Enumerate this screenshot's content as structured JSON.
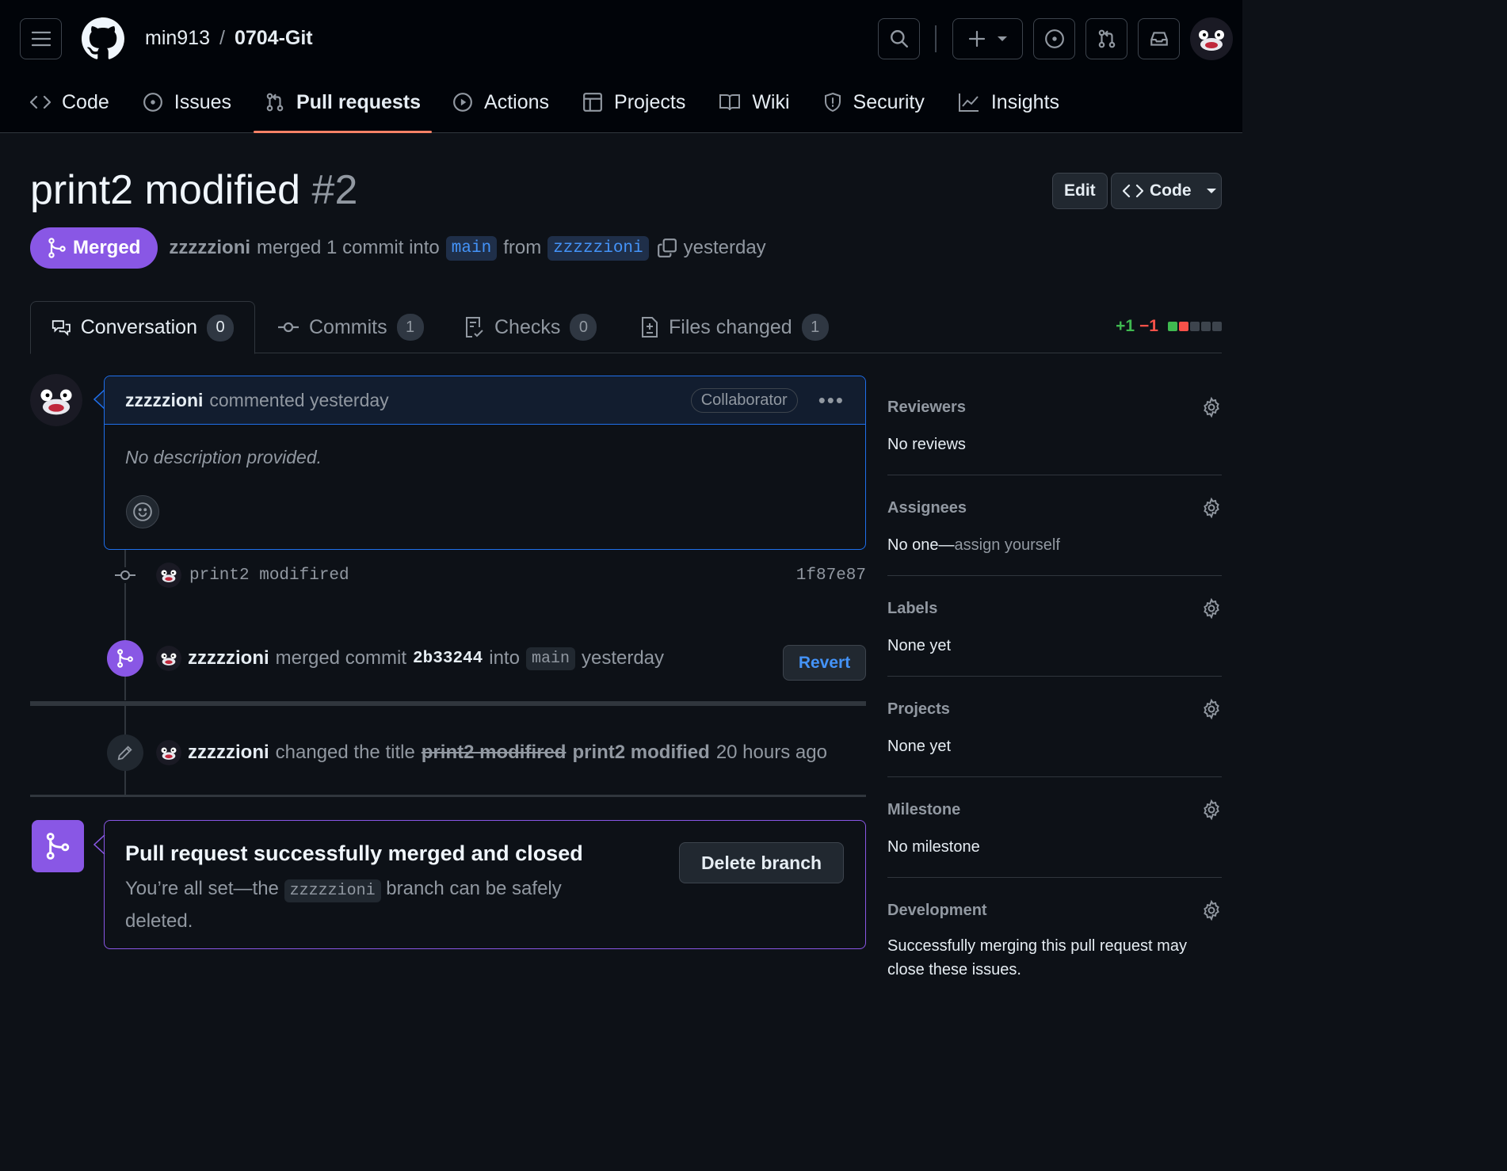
{
  "header": {
    "owner": "min913",
    "separator": "/",
    "repo": "0704-Git",
    "plus_label": "+"
  },
  "repo_tabs": [
    {
      "label": "Code"
    },
    {
      "label": "Issues"
    },
    {
      "label": "Pull requests",
      "active": true
    },
    {
      "label": "Actions"
    },
    {
      "label": "Projects"
    },
    {
      "label": "Wiki"
    },
    {
      "label": "Security"
    },
    {
      "label": "Insights"
    }
  ],
  "pr": {
    "title": "print2 modified",
    "number": "#2",
    "edit_label": "Edit",
    "code_label": "Code",
    "state": "Merged",
    "author": "zzzzzioni",
    "merge_text": "merged 1 commit into",
    "base_branch": "main",
    "from_text": "from",
    "head_branch": "zzzzzioni",
    "time": "yesterday"
  },
  "pr_tabs": [
    {
      "label": "Conversation",
      "count": "0"
    },
    {
      "label": "Commits",
      "count": "1"
    },
    {
      "label": "Checks",
      "count": "0"
    },
    {
      "label": "Files changed",
      "count": "1"
    }
  ],
  "diffstat": {
    "added": "+1",
    "removed": "−1"
  },
  "comment": {
    "author": "zzzzzioni",
    "action": "commented yesterday",
    "role": "Collaborator",
    "body": "No description provided."
  },
  "timeline": {
    "commit": {
      "message": "print2 modifired",
      "sha": "1f87e87"
    },
    "merge_event": {
      "user": "zzzzzioni",
      "text1": "merged commit",
      "sha": "2b33244",
      "text2": "into",
      "branch": "main",
      "time": "yesterday",
      "revert_label": "Revert"
    },
    "rename_event": {
      "user": "zzzzzioni",
      "text": "changed the title",
      "old_title": "print2 modifired",
      "new_title": "print2 modified",
      "time": "20 hours ago"
    }
  },
  "merged_box": {
    "title": "Pull request successfully merged and closed",
    "text1": "You’re all set—the",
    "branch": "zzzzzioni",
    "text2": "branch can be safely deleted.",
    "delete_label": "Delete branch"
  },
  "sidebar": {
    "reviewers": {
      "title": "Reviewers",
      "value": "No reviews"
    },
    "assignees": {
      "title": "Assignees",
      "value": "No one—",
      "link": "assign yourself"
    },
    "labels": {
      "title": "Labels",
      "value": "None yet"
    },
    "projects": {
      "title": "Projects",
      "value": "None yet"
    },
    "milestone": {
      "title": "Milestone",
      "value": "No milestone"
    },
    "development": {
      "title": "Development",
      "value": "Successfully merging this pull request may close these issues."
    }
  },
  "colors": {
    "accent_merged": "#8957e5",
    "tab_underline": "#f78166",
    "link_blue": "#4493f8",
    "diff_green": "#3fb950",
    "diff_red": "#f85149"
  }
}
